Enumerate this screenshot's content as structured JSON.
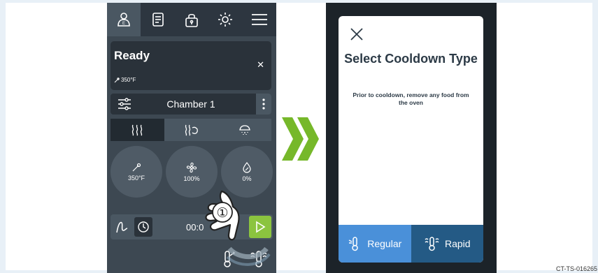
{
  "left_screen": {
    "status": "Ready",
    "status_temp": "350°F",
    "chamber": "Chamber 1",
    "dials": [
      {
        "icon": "thermometer-icon",
        "value": "350°F"
      },
      {
        "icon": "fan-icon",
        "value": "100%"
      },
      {
        "icon": "humidity-icon",
        "value": "0%"
      }
    ],
    "timer": "00:0",
    "callout_step": "①"
  },
  "right_screen": {
    "dialog_title": "Select Cooldown Type",
    "dialog_message": "Prior to cooldown, remove any food from the oven",
    "option_regular": "Regular",
    "option_rapid": "Rapid"
  },
  "doc_code": "CT-TS-016265",
  "colors": {
    "panel_dark": "#3d4852",
    "play_green": "#8bc43f",
    "chevron_green": "#76b82a",
    "regular_blue": "#4a90d9",
    "rapid_blue": "#245a85"
  }
}
